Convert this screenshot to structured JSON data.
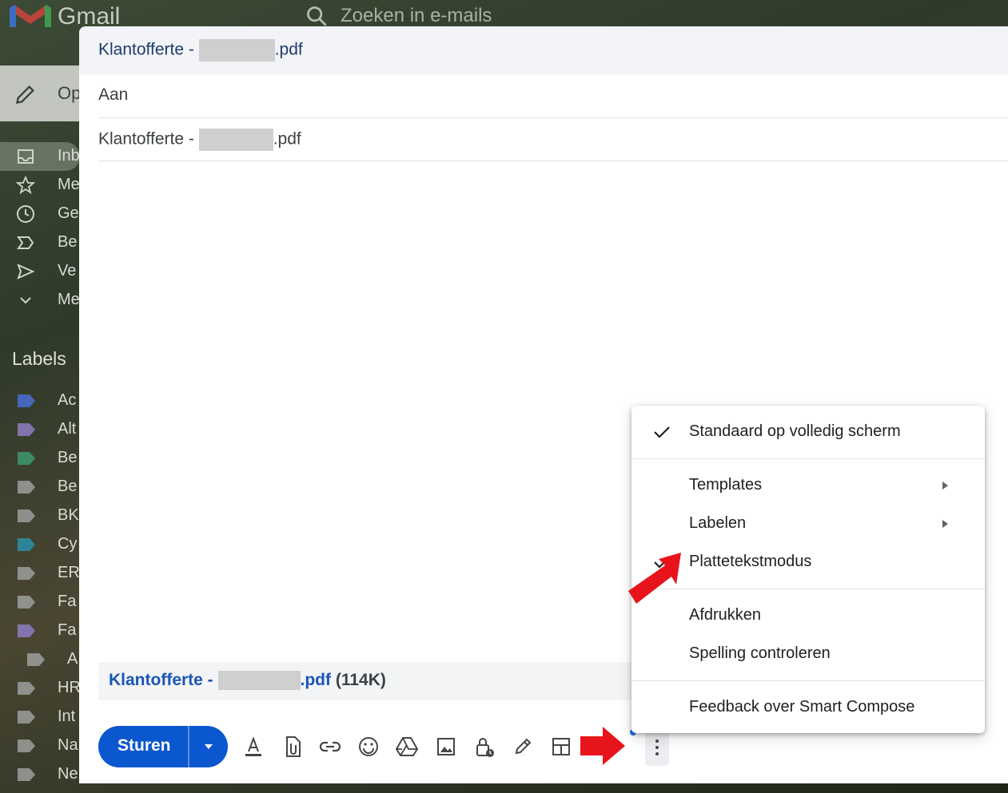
{
  "background": {
    "app_name": "Gmail",
    "search_placeholder": "Zoeken in e-mails",
    "compose_label": "Op",
    "nav": [
      {
        "icon": "inbox-icon",
        "label": "Inb"
      },
      {
        "icon": "star-icon",
        "label": "Me"
      },
      {
        "icon": "clock-icon",
        "label": "Ge"
      },
      {
        "icon": "label-important-icon",
        "label": "Be"
      },
      {
        "icon": "send-icon",
        "label": "Ve"
      },
      {
        "icon": "chevron-down-icon",
        "label": "Me"
      }
    ],
    "labels_title": "Labels",
    "labels": [
      {
        "label": "Ac",
        "color": "#4a6fd6"
      },
      {
        "label": "Alt",
        "color": "#8e7cc3"
      },
      {
        "label": "Be",
        "color": "#3d9970"
      },
      {
        "label": "Be",
        "color": "#9e9e9e"
      },
      {
        "label": "BK",
        "color": "#9e9e9e"
      },
      {
        "label": "Cy",
        "color": "#2a8fa8"
      },
      {
        "label": "ER",
        "color": "#9e9e9e"
      },
      {
        "label": "Fa",
        "color": "#9e9e9e"
      },
      {
        "label": "Fa",
        "color": "#8e7cc3"
      },
      {
        "label": "A",
        "color": "#9e9e9e"
      },
      {
        "label": "HR",
        "color": "#9e9e9e"
      },
      {
        "label": "Int",
        "color": "#9e9e9e"
      },
      {
        "label": "Na",
        "color": "#9e9e9e"
      },
      {
        "label": "Ne",
        "color": "#9e9e9e"
      }
    ]
  },
  "compose": {
    "header_prefix": "Klantofferte - ",
    "header_suffix": ".pdf",
    "to_label": "Aan",
    "subject_prefix": "Klantofferte - ",
    "subject_suffix": ".pdf",
    "attachment_prefix": "Klantofferte - ",
    "attachment_suffix": ".pdf",
    "attachment_size": "(114K)",
    "send_label": "Sturen",
    "toolbar_icons": [
      "text-format-icon",
      "attach-file-icon",
      "link-icon",
      "emoji-icon",
      "google-drive-icon",
      "image-icon",
      "confidential-mode-icon",
      "signature-icon",
      "layout-icon"
    ]
  },
  "menu": {
    "items": [
      {
        "label": "Standaard op volledig scherm",
        "checked": true,
        "submenu": false
      },
      {
        "label": "Templates",
        "checked": false,
        "submenu": true
      },
      {
        "label": "Labelen",
        "checked": false,
        "submenu": true
      },
      {
        "label": "Plattetekstmodus",
        "checked": true,
        "submenu": false
      },
      {
        "label": "Afdrukken",
        "checked": false,
        "submenu": false
      },
      {
        "label": "Spelling controleren",
        "checked": false,
        "submenu": false
      },
      {
        "label": "Feedback over Smart Compose",
        "checked": false,
        "submenu": false
      }
    ]
  },
  "colors": {
    "accent": "#0b57d0",
    "annotation_arrow": "#e8141b"
  }
}
